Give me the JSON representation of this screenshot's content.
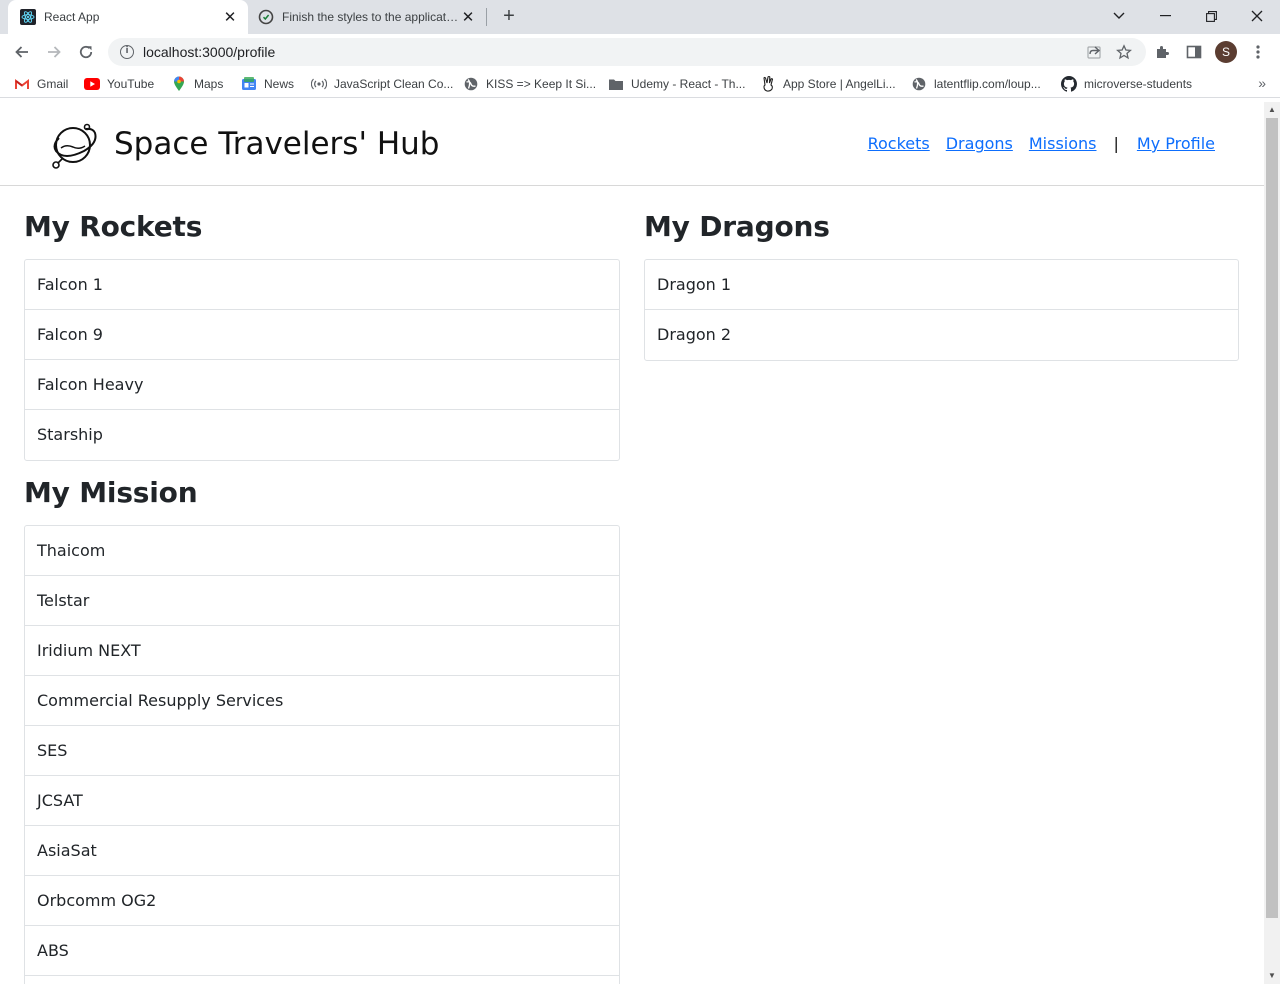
{
  "browser": {
    "tabs": [
      {
        "title": "React App",
        "favicon": "react-icon"
      },
      {
        "title": "Finish the styles to the application",
        "favicon": "github-icon"
      }
    ],
    "url": "localhost:3000/profile",
    "profile_initial": "S",
    "bookmarks": [
      {
        "label": "Gmail",
        "icon": "gmail-icon"
      },
      {
        "label": "YouTube",
        "icon": "youtube-icon"
      },
      {
        "label": "Maps",
        "icon": "maps-icon"
      },
      {
        "label": "News",
        "icon": "news-icon"
      },
      {
        "label": "JavaScript Clean Co...",
        "icon": "podcast-icon"
      },
      {
        "label": "KISS => Keep It Si...",
        "icon": "globe-icon"
      },
      {
        "label": "Udemy - React - Th...",
        "icon": "folder-icon"
      },
      {
        "label": "App Store | AngelLi...",
        "icon": "angellist-icon"
      },
      {
        "label": "latentflip.com/loup...",
        "icon": "globe-icon"
      },
      {
        "label": "microverse-students",
        "icon": "github-icon"
      }
    ]
  },
  "header": {
    "title": "Space Travelers' Hub",
    "nav": {
      "rockets": "Rockets",
      "dragons": "Dragons",
      "missions": "Missions",
      "divider": "|",
      "profile": "My Profile"
    }
  },
  "rockets": {
    "title": "My Rockets",
    "items": [
      "Falcon 1",
      "Falcon 9",
      "Falcon Heavy",
      "Starship"
    ]
  },
  "dragons": {
    "title": "My Dragons",
    "items": [
      "Dragon 1",
      "Dragon 2"
    ]
  },
  "missions": {
    "title": "My Mission",
    "items": [
      "Thaicom",
      "Telstar",
      "Iridium NEXT",
      "Commercial Resupply Services",
      "SES",
      "JCSAT",
      "AsiaSat",
      "Orbcomm OG2",
      "ABS",
      ""
    ]
  }
}
